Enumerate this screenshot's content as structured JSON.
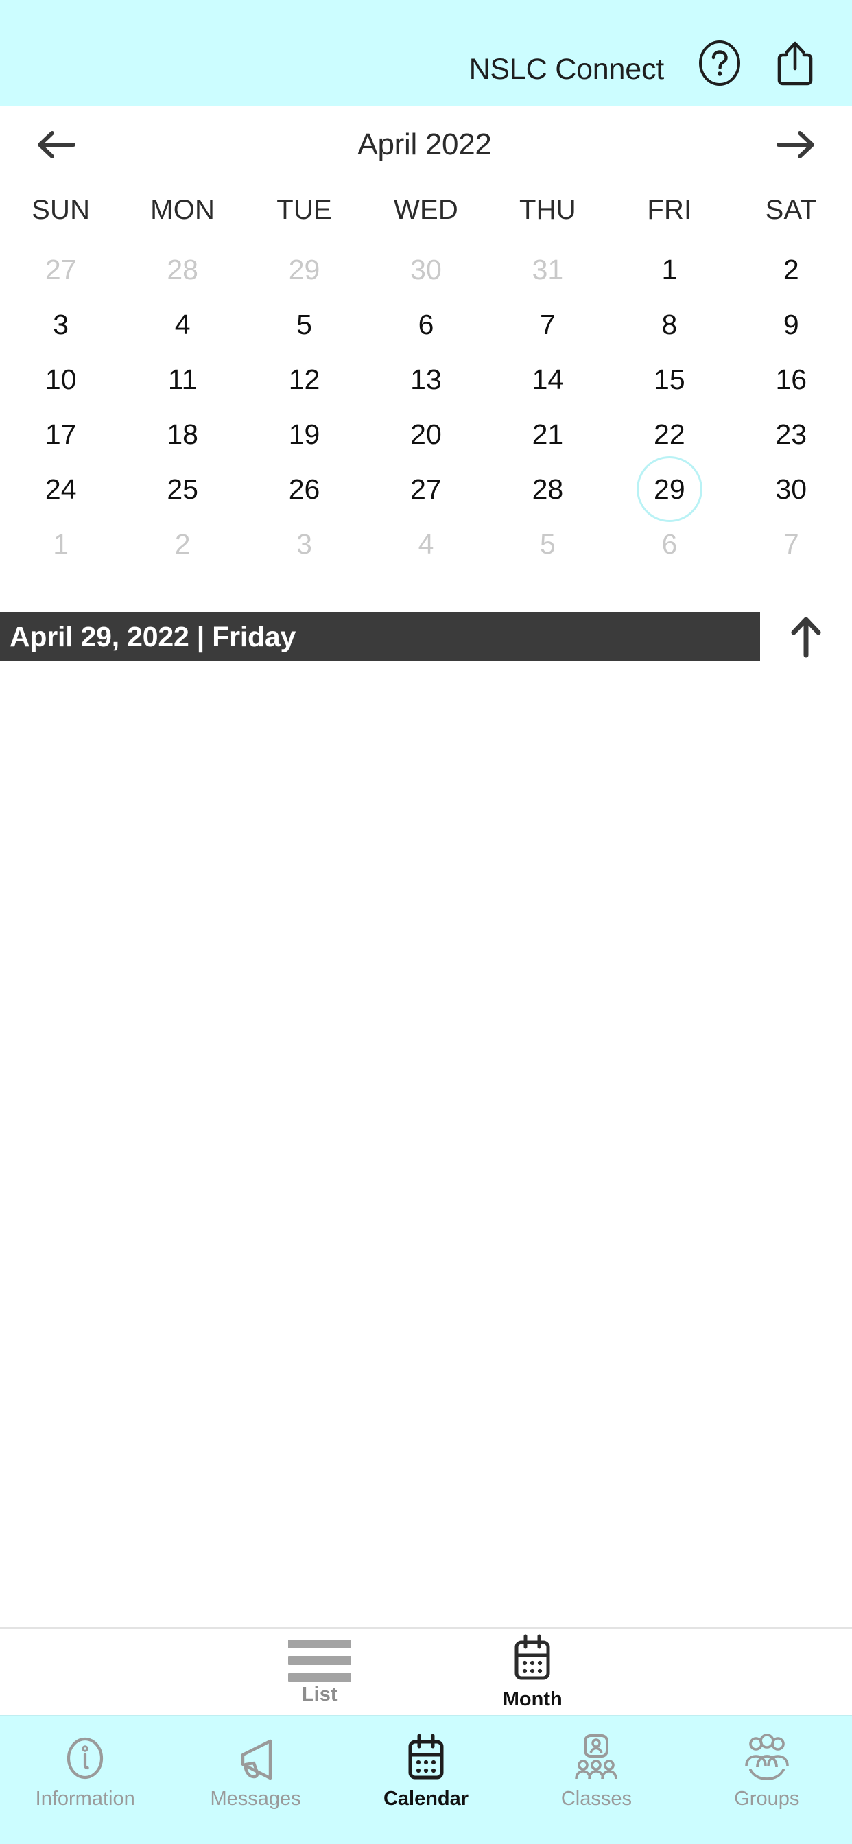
{
  "header": {
    "title": "NSLC Connect",
    "help_icon": "question-circle-icon",
    "share_icon": "share-icon",
    "background_color": "#CCFDFF"
  },
  "month_nav": {
    "prev_label": "←",
    "next_label": "→",
    "title": "April 2022"
  },
  "weekdays": [
    "SUN",
    "MON",
    "TUE",
    "WED",
    "THU",
    "FRI",
    "SAT"
  ],
  "calendar": {
    "month": "April",
    "year": "2022",
    "selected_day": "29",
    "selected_color": "#B9F2F5",
    "muted_color": "#C9C9C9",
    "weeks": [
      [
        {
          "n": "27",
          "muted": true
        },
        {
          "n": "28",
          "muted": true
        },
        {
          "n": "29",
          "muted": true
        },
        {
          "n": "30",
          "muted": true
        },
        {
          "n": "31",
          "muted": true
        },
        {
          "n": "1",
          "muted": false
        },
        {
          "n": "2",
          "muted": false
        }
      ],
      [
        {
          "n": "3",
          "muted": false
        },
        {
          "n": "4",
          "muted": false
        },
        {
          "n": "5",
          "muted": false
        },
        {
          "n": "6",
          "muted": false
        },
        {
          "n": "7",
          "muted": false
        },
        {
          "n": "8",
          "muted": false
        },
        {
          "n": "9",
          "muted": false
        }
      ],
      [
        {
          "n": "10",
          "muted": false
        },
        {
          "n": "11",
          "muted": false
        },
        {
          "n": "12",
          "muted": false
        },
        {
          "n": "13",
          "muted": false
        },
        {
          "n": "14",
          "muted": false
        },
        {
          "n": "15",
          "muted": false
        },
        {
          "n": "16",
          "muted": false
        }
      ],
      [
        {
          "n": "17",
          "muted": false
        },
        {
          "n": "18",
          "muted": false
        },
        {
          "n": "19",
          "muted": false
        },
        {
          "n": "20",
          "muted": false
        },
        {
          "n": "21",
          "muted": false
        },
        {
          "n": "22",
          "muted": false
        },
        {
          "n": "23",
          "muted": false
        }
      ],
      [
        {
          "n": "24",
          "muted": false
        },
        {
          "n": "25",
          "muted": false
        },
        {
          "n": "26",
          "muted": false
        },
        {
          "n": "27",
          "muted": false
        },
        {
          "n": "28",
          "muted": false
        },
        {
          "n": "29",
          "muted": false,
          "selected": true
        },
        {
          "n": "30",
          "muted": false
        }
      ],
      [
        {
          "n": "1",
          "muted": true
        },
        {
          "n": "2",
          "muted": true
        },
        {
          "n": "3",
          "muted": true
        },
        {
          "n": "4",
          "muted": true
        },
        {
          "n": "5",
          "muted": true
        },
        {
          "n": "6",
          "muted": true
        },
        {
          "n": "7",
          "muted": true
        }
      ]
    ]
  },
  "date_bar": {
    "text": "April 29, 2022 | Friday",
    "background_color": "#3B3B3B",
    "collapse_icon": "arrow-up-icon"
  },
  "view_toggle": {
    "items": [
      {
        "label": "List",
        "icon": "list-icon",
        "active": false
      },
      {
        "label": "Month",
        "icon": "calendar-icon",
        "active": true
      }
    ]
  },
  "tab_bar": {
    "items": [
      {
        "label": "Information",
        "icon": "info-circle-icon",
        "active": false
      },
      {
        "label": "Messages",
        "icon": "megaphone-icon",
        "active": false
      },
      {
        "label": "Calendar",
        "icon": "calendar-icon",
        "active": true
      },
      {
        "label": "Classes",
        "icon": "classes-icon",
        "active": false
      },
      {
        "label": "Groups",
        "icon": "groups-icon",
        "active": false
      }
    ]
  }
}
